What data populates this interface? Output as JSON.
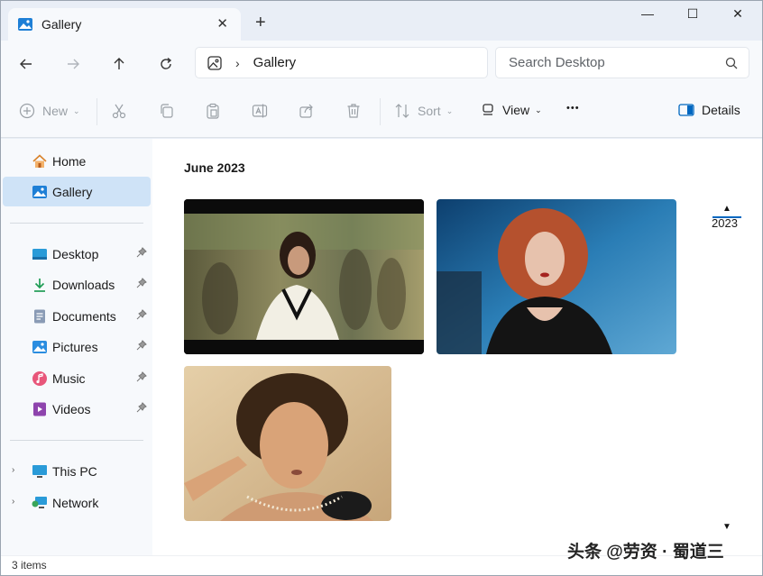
{
  "tab": {
    "title": "Gallery",
    "close": "✕",
    "new_tab": "+"
  },
  "window_controls": {
    "minimize": "—",
    "maximize": "☐",
    "close": "✕"
  },
  "address": {
    "breadcrumb_sep": "›",
    "current": "Gallery"
  },
  "search": {
    "placeholder": "Search Desktop"
  },
  "toolbar": {
    "new_label": "New",
    "sort_label": "Sort",
    "view_label": "View",
    "more_label": "•••",
    "details_label": "Details"
  },
  "sidebar": {
    "quick": [
      {
        "label": "Home",
        "icon": "home-icon"
      },
      {
        "label": "Gallery",
        "icon": "gallery-icon"
      }
    ],
    "pinned": [
      {
        "label": "Desktop",
        "icon": "desktop-icon"
      },
      {
        "label": "Downloads",
        "icon": "downloads-icon"
      },
      {
        "label": "Documents",
        "icon": "documents-icon"
      },
      {
        "label": "Pictures",
        "icon": "pictures-icon"
      },
      {
        "label": "Music",
        "icon": "music-icon"
      },
      {
        "label": "Videos",
        "icon": "videos-icon"
      }
    ],
    "tree": [
      {
        "label": "This PC",
        "icon": "this-pc-icon"
      },
      {
        "label": "Network",
        "icon": "network-icon"
      }
    ],
    "expand_glyph": "›"
  },
  "main": {
    "group_title": "June 2023",
    "photos": [
      {
        "name": "photo-1",
        "description": "woman in white blouse walking"
      },
      {
        "name": "photo-2",
        "description": "red-haired woman in black"
      },
      {
        "name": "photo-3",
        "description": "woman applying makeup"
      }
    ],
    "year": "2023",
    "scroll_up": "▲",
    "scroll_down": "▼"
  },
  "status": {
    "items": "3 items"
  },
  "watermark": "头条 @劳资 · 蜀道三",
  "colors": {
    "accent": "#0067c0",
    "selected": "#cfe3f7",
    "chrome": "#e9eef6"
  }
}
